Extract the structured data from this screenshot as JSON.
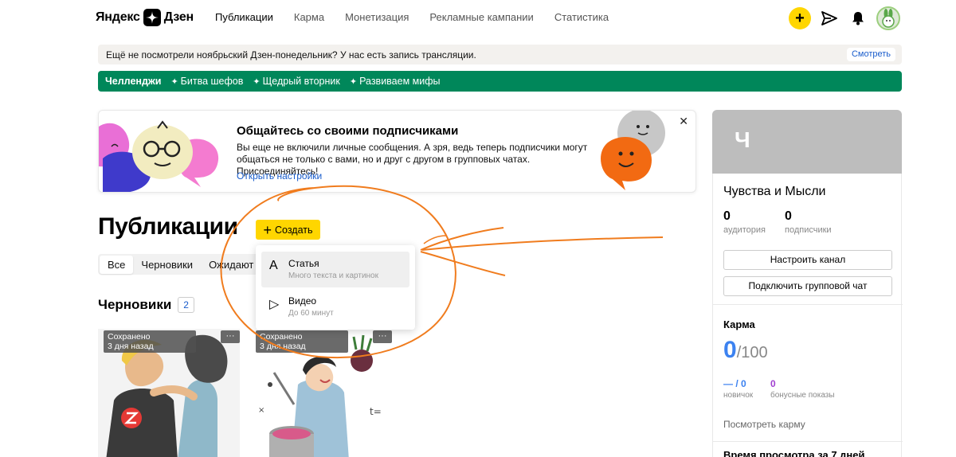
{
  "header": {
    "logo_left": "Яндекс",
    "logo_right": "Дзен",
    "nav": [
      {
        "label": "Публикации",
        "active": true
      },
      {
        "label": "Карма"
      },
      {
        "label": "Монетизация"
      },
      {
        "label": "Рекламные кампании"
      },
      {
        "label": "Статистика"
      }
    ]
  },
  "notice": {
    "text": "Ещё не посмотрели ноябрьский Дзен-понедельник? У нас есть запись трансляции.",
    "button": "Смотреть"
  },
  "challenges": {
    "title": "Челленджи",
    "items": [
      "Битва шефов",
      "Щедрый вторник",
      "Развиваем мифы"
    ]
  },
  "promo": {
    "title": "Общайтесь со своими подписчиками",
    "text": "Вы еще не включили личные сообщения. А зря, ведь теперь подписчики могут общаться не только с вами, но и друг с другом в групповых чатах. Присоединяйтесь!",
    "link": "Открыть настройки"
  },
  "main": {
    "title": "Публикации",
    "create_button": "Создать",
    "tabs": [
      "Все",
      "Черновики",
      "Ожидают п"
    ],
    "drafts_title": "Черновики",
    "drafts_count": "2",
    "cards": [
      {
        "status": "Сохранено",
        "time": "3 дня назад"
      },
      {
        "status": "Сохранено",
        "time": "3 дня назад"
      }
    ],
    "card_menu": "···"
  },
  "dropdown": {
    "items": [
      {
        "icon": "A",
        "title": "Статья",
        "subtitle": "Много текста и картинок"
      },
      {
        "icon": "▷",
        "title": "Видео",
        "subtitle": "До 60 минут"
      }
    ]
  },
  "right_panel": {
    "initial": "Ч",
    "channel_name": "Чувства и Мысли",
    "stats": [
      {
        "value": "0",
        "label": "аудитория"
      },
      {
        "value": "0",
        "label": "подписчики"
      }
    ],
    "buttons": [
      "Настроить канал",
      "Подключить групповой чат"
    ],
    "karma": {
      "title": "Карма",
      "value": "0",
      "max": "/100",
      "sub": [
        {
          "value": "— / 0",
          "label": "новичок"
        },
        {
          "value": "0",
          "label": "бонусные показы"
        }
      ],
      "link": "Посмотреть карму"
    },
    "view_time": "Время просмотра за 7 дней"
  },
  "colors": {
    "accent_yellow": "#ffd600",
    "challenge_green": "#00875a",
    "link_blue": "#1a5dcc",
    "karma_blue": "#3c82f0",
    "annotation_orange": "#f07c1e"
  }
}
